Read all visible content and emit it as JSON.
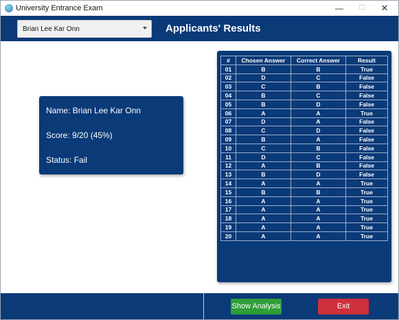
{
  "window": {
    "title": "University Entrance Exam",
    "minimize": "—",
    "maximize": "☐",
    "close": "✕"
  },
  "header": {
    "selected_applicant": "Brian Lee Kar Onn",
    "title": "Applicants' Results"
  },
  "summary": {
    "name": "Name: Brian Lee Kar Onn",
    "score": "Score: 9/20 (45%)",
    "status": "Status: Fail"
  },
  "results": {
    "headers": [
      "#",
      "Chosen Answer",
      "Correct Answer",
      "Result"
    ],
    "rows": [
      [
        "01",
        "B",
        "B",
        "True"
      ],
      [
        "02",
        "D",
        "C",
        "False"
      ],
      [
        "03",
        "C",
        "B",
        "False"
      ],
      [
        "04",
        "B",
        "C",
        "False"
      ],
      [
        "05",
        "B",
        "D",
        "False"
      ],
      [
        "06",
        "A",
        "A",
        "True"
      ],
      [
        "07",
        "D",
        "A",
        "False"
      ],
      [
        "08",
        "C",
        "D",
        "False"
      ],
      [
        "09",
        "B",
        "A",
        "False"
      ],
      [
        "10",
        "C",
        "B",
        "False"
      ],
      [
        "11",
        "D",
        "C",
        "False"
      ],
      [
        "12",
        "A",
        "B",
        "False"
      ],
      [
        "13",
        "B",
        "D",
        "False"
      ],
      [
        "14",
        "A",
        "A",
        "True"
      ],
      [
        "15",
        "B",
        "B",
        "True"
      ],
      [
        "16",
        "A",
        "A",
        "True"
      ],
      [
        "17",
        "A",
        "A",
        "True"
      ],
      [
        "18",
        "A",
        "A",
        "True"
      ],
      [
        "19",
        "A",
        "A",
        "True"
      ],
      [
        "20",
        "A",
        "A",
        "True"
      ]
    ]
  },
  "footer": {
    "analysis_label": "Show Analysis",
    "exit_label": "Exit"
  },
  "colors": {
    "primary": "#0a3a78",
    "analysis": "#2e9e3a",
    "exit": "#cf2f3b"
  }
}
